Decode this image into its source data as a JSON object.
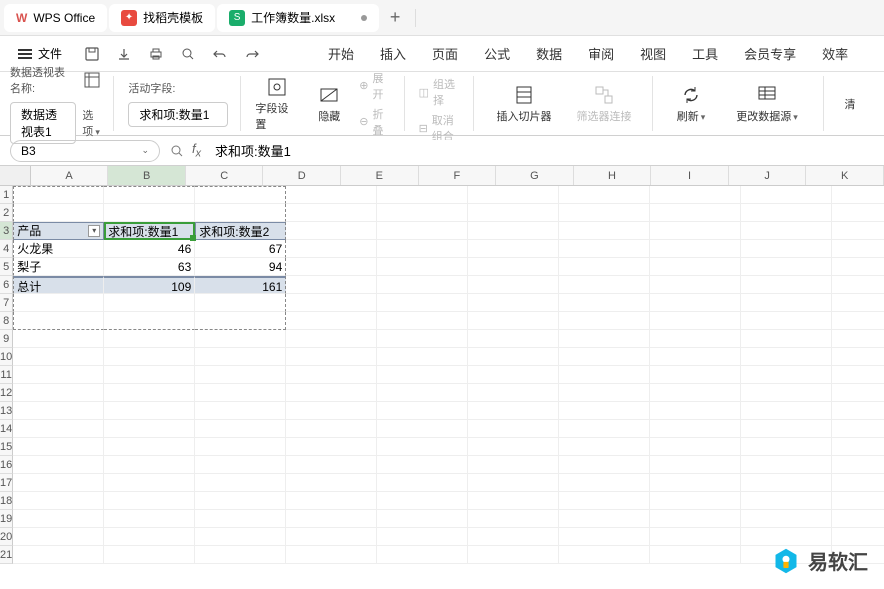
{
  "tabs": {
    "app_name": "WPS Office",
    "template_tab": "找稻壳模板",
    "file_tab": "工作簿数量.xlsx",
    "add": "+"
  },
  "menu": {
    "file": "文件",
    "ribbon": [
      "开始",
      "插入",
      "页面",
      "公式",
      "数据",
      "审阅",
      "视图",
      "工具",
      "会员专享",
      "效率"
    ]
  },
  "pivot_tools": {
    "name_label": "数据透视表名称:",
    "name_value": "数据透视表1",
    "options": "选项",
    "active_label": "活动字段:",
    "active_value": "求和项:数量1",
    "field_settings": "字段设置",
    "hide": "隐藏",
    "expand": "展开",
    "collapse": "折叠",
    "group_sel": "组选择",
    "ungroup": "取消组合",
    "insert_slicer": "插入切片器",
    "filter_conn": "筛选器连接",
    "refresh": "刷新",
    "change_source": "更改数据源",
    "clear": "清"
  },
  "formula_bar": {
    "name_box": "B3",
    "fx": "求和项:数量1"
  },
  "grid": {
    "cols": [
      "A",
      "B",
      "C",
      "D",
      "E",
      "F",
      "G",
      "H",
      "I",
      "J",
      "K"
    ],
    "rows": 21,
    "sel_col": "B",
    "sel_row": 3
  },
  "pivot": {
    "headers": [
      "产品",
      "求和项:数量1",
      "求和项:数量2"
    ],
    "rows": [
      {
        "label": "火龙果",
        "v1": "46",
        "v2": "67"
      },
      {
        "label": "梨子",
        "v1": "63",
        "v2": "94"
      }
    ],
    "total_label": "总计",
    "total_v1": "109",
    "total_v2": "161"
  },
  "watermark": "易软汇",
  "chart_data": {
    "type": "table",
    "title": "数据透视表1",
    "columns": [
      "产品",
      "求和项:数量1",
      "求和项:数量2"
    ],
    "data": [
      [
        "火龙果",
        46,
        67
      ],
      [
        "梨子",
        63,
        94
      ],
      [
        "总计",
        109,
        161
      ]
    ]
  }
}
